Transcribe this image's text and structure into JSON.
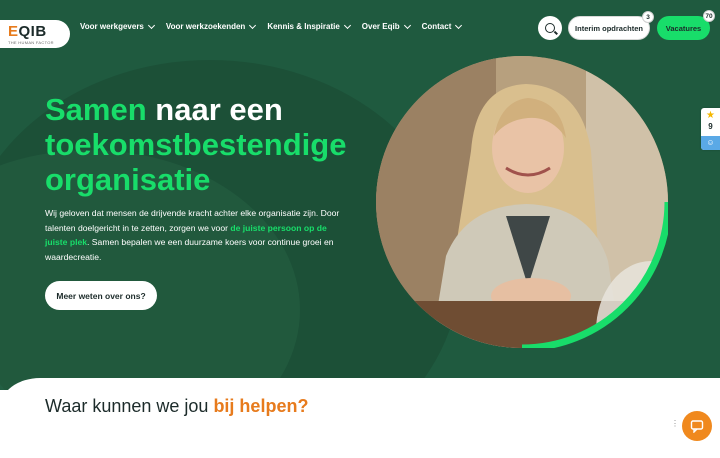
{
  "brand": {
    "logo_prefix": "E",
    "logo_rest": "QIB",
    "tagline": "THE HUMAN FACTOR",
    "accent": "#18dd6a",
    "orange": "#e77b1d",
    "hero_bg": "#1f5a3f"
  },
  "nav": {
    "items": [
      {
        "label": "Voor werkgevers"
      },
      {
        "label": "Voor werkzoekenden"
      },
      {
        "label": "Kennis & Inspiratie"
      },
      {
        "label": "Over Eqib"
      },
      {
        "label": "Contact"
      }
    ],
    "interim": {
      "label": "Interim opdrachten",
      "count": "3"
    },
    "vacatures": {
      "label": "Vacatures",
      "count": "70"
    }
  },
  "hero": {
    "title_a": "Samen",
    "title_b": " naar een ",
    "title_c": "toekomstbestendige organisatie",
    "lead_a": "Wij geloven dat mensen de drijvende kracht achter elke organisatie zijn. Door talenten doelgericht in te zetten, zorgen we voor ",
    "lead_hl": "de juiste persoon op de juiste plek",
    "lead_b": ". Samen bepalen we een duurzame koers voor continue groei en waardecreatie.",
    "cta": "Meer weten over ons?"
  },
  "rating": {
    "score": "9",
    "star": "★"
  },
  "section": {
    "title_a": "Waar kunnen we jou ",
    "title_b": "bij helpen?"
  }
}
